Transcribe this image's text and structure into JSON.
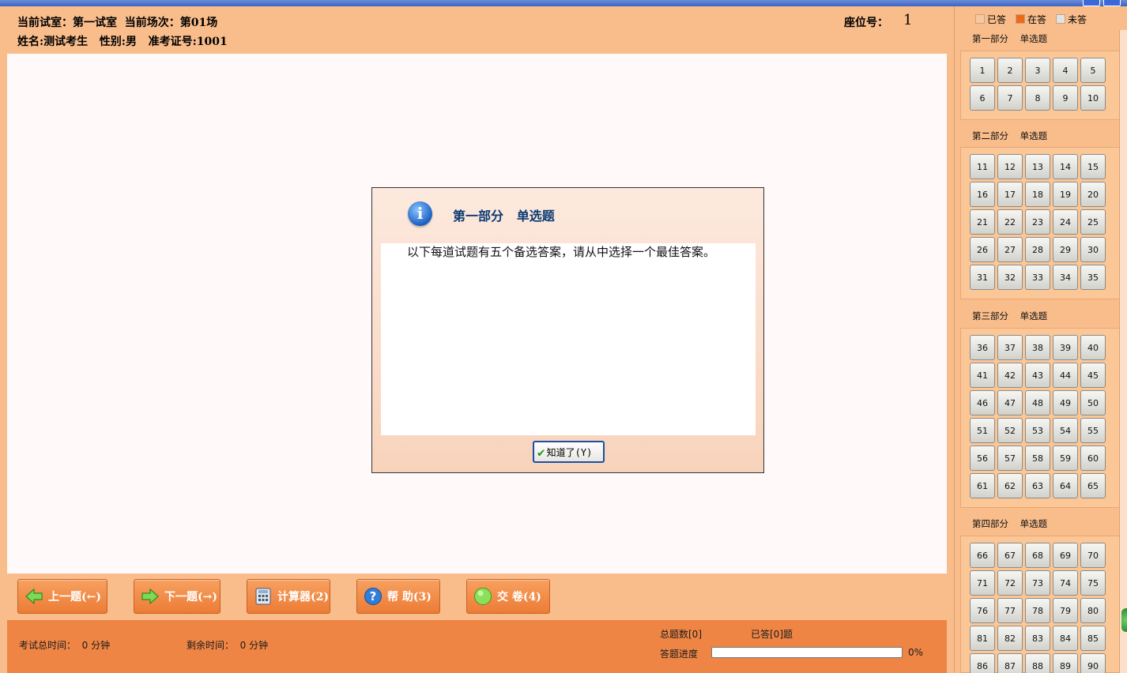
{
  "header": {
    "line1": "当前试室：第一试室  当前场次：第01场",
    "line2": "姓名:测试考生   性别:男   准考证号:1001",
    "seat_label": "座位号：",
    "seat_value": "1"
  },
  "dialog": {
    "title": "第一部分   单选题",
    "icon": "info-icon",
    "body": "以下每道试题有五个备选答案，请从中选择一个最佳答案。",
    "ok_label": "知道了(Y)"
  },
  "nav": {
    "prev": "上一题(←)",
    "next": "下一题(→)",
    "calc": "计算器(2)",
    "help": "帮  助(3)",
    "submit": "交  卷(4)"
  },
  "footer": {
    "total_time": "考试总时间：  0 分钟",
    "remaining_time": "剩余时间：  0 分钟",
    "total_count": "总题数[0]",
    "answered": "已答[0]题",
    "progress_label": "答题进度",
    "progress_pct": "0%",
    "progress_value": 0
  },
  "legend": [
    {
      "label": "已答",
      "color": "#f9c6a4"
    },
    {
      "label": "在答",
      "color": "#ec6a1a"
    },
    {
      "label": "未答",
      "color": "#e2e2e2"
    }
  ],
  "sections": [
    {
      "title": "第一部分    单选题",
      "questions": [
        "1",
        "2",
        "3",
        "4",
        "5",
        "6",
        "7",
        "8",
        "9",
        "10"
      ]
    },
    {
      "title": "第二部分    单选题",
      "questions": [
        "11",
        "12",
        "13",
        "14",
        "15",
        "16",
        "17",
        "18",
        "19",
        "20",
        "21",
        "22",
        "23",
        "24",
        "25",
        "26",
        "27",
        "28",
        "29",
        "30",
        "31",
        "32",
        "33",
        "34",
        "35"
      ]
    },
    {
      "title": "第三部分    单选题",
      "questions": [
        "36",
        "37",
        "38",
        "39",
        "40",
        "41",
        "42",
        "43",
        "44",
        "45",
        "46",
        "47",
        "48",
        "49",
        "50",
        "51",
        "52",
        "53",
        "54",
        "55",
        "56",
        "57",
        "58",
        "59",
        "60",
        "61",
        "62",
        "63",
        "64",
        "65"
      ]
    },
    {
      "title": "第四部分    单选题",
      "questions": [
        "66",
        "67",
        "68",
        "69",
        "70",
        "71",
        "72",
        "73",
        "74",
        "75",
        "76",
        "77",
        "78",
        "79",
        "80",
        "81",
        "82",
        "83",
        "84",
        "85",
        "86",
        "87",
        "88",
        "89",
        "90"
      ]
    }
  ]
}
